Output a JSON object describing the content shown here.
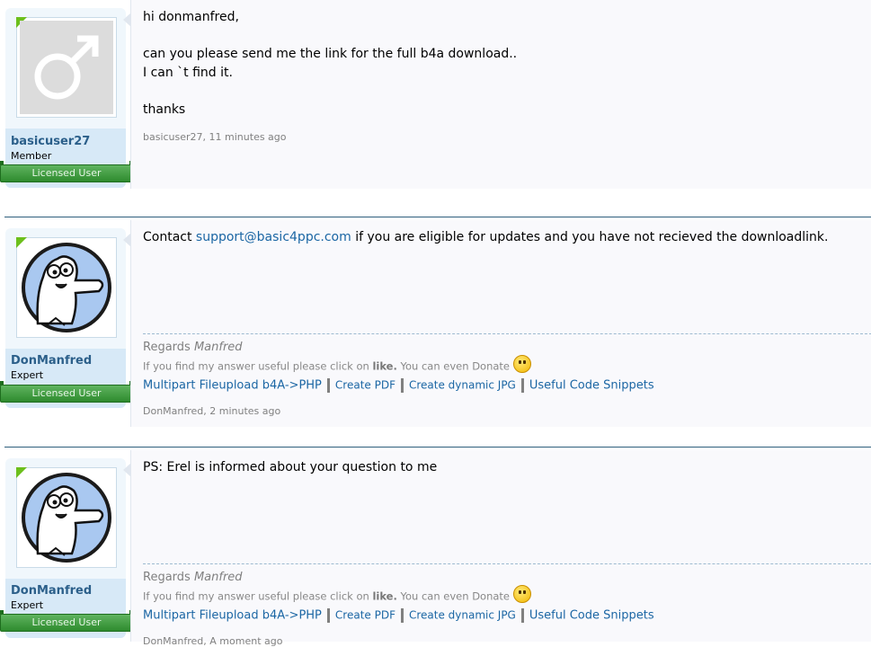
{
  "posts": [
    {
      "username": "basicuser27",
      "usertitle": "Member",
      "ribbon": "Licensed User",
      "avatar": "male-symbol-avatar",
      "message": "hi donmanfred,\n\ncan you please send me the link for the full b4a download..\nI can `t find it.\n\nthanks",
      "meta": "basicuser27, 11 minutes ago"
    },
    {
      "username": "DonManfred",
      "usertitle": "Expert",
      "ribbon": "Licensed User",
      "avatar": "cartoon-cat-avatar",
      "message_pre": "Contact ",
      "message_link": "support@basic4ppc.com",
      "message_post": " if you are eligible for updates and you have not recieved the downloadlink.",
      "meta": "DonManfred, 2 minutes ago"
    },
    {
      "username": "DonManfred",
      "usertitle": "Expert",
      "ribbon": "Licensed User",
      "avatar": "cartoon-cat-avatar",
      "message": "PS: Erel is informed about your question to me",
      "meta": "DonManfred, A moment ago"
    }
  ],
  "signature": {
    "regards_label": "Regards ",
    "regards_name": "Manfred",
    "note_pre": "If you find my answer useful please click on ",
    "note_bold": "like.",
    "note_post": " You can even Donate ",
    "links": [
      "Multipart Fileupload b4A->PHP",
      "Create PDF",
      "Create dynamic JPG",
      "Useful Code Snippets"
    ]
  },
  "colors": {
    "username": "#2b5f8a",
    "link": "#1b66a4",
    "ribbon": "#2e8b2e",
    "separator": "#2f5f7d"
  }
}
